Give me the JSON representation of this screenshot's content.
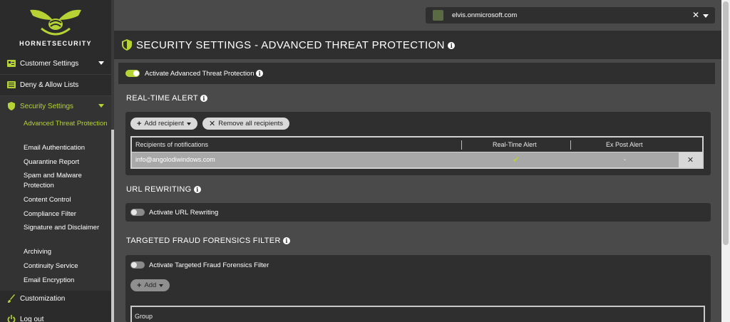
{
  "brand": {
    "logo_text": "HORNETSECURITY",
    "accent": "#b5d334"
  },
  "sidebar": {
    "top_items": [
      {
        "label": "Customer Settings",
        "icon": "id-card-icon"
      },
      {
        "label": "Deny & Allow Lists",
        "icon": "list-icon"
      },
      {
        "label": "Security Settings",
        "icon": "shield-icon"
      }
    ],
    "sub_items": [
      {
        "label": "Advanced Threat Protection",
        "active": true
      },
      {
        "label": "Email Authentication"
      },
      {
        "label": "Quarantine Report"
      },
      {
        "label": "Spam and Malware Protection"
      },
      {
        "label": "Content Control"
      },
      {
        "label": "Compliance Filter"
      },
      {
        "label": "Signature and Disclaimer"
      },
      {
        "label": "Archiving"
      },
      {
        "label": "Continuity Service"
      },
      {
        "label": "Email Encryption"
      }
    ],
    "bottom_items": [
      {
        "label": "Customization",
        "icon": "brush-icon"
      },
      {
        "label": "Log out",
        "icon": "power-icon"
      }
    ]
  },
  "topbar": {
    "tenant": "elvis.onmicrosoft.com"
  },
  "page": {
    "title": "SECURITY SETTINGS - ADVANCED THREAT PROTECTION",
    "activate_atp": "Activate Advanced Threat Protection"
  },
  "realtime": {
    "heading": "REAL-TIME ALERT",
    "add_recipient": "Add recipient",
    "remove_all": "Remove all recipients",
    "columns": [
      "Recipients of notifications",
      "Real-Time Alert",
      "Ex Post Alert"
    ],
    "rows": [
      {
        "email": "info@angolodiwindows.com",
        "realtime": "✔",
        "expost": "-"
      }
    ]
  },
  "url_rewriting": {
    "heading": "URL REWRITING",
    "activate": "Activate URL Rewriting"
  },
  "fraud": {
    "heading": "TARGETED FRAUD FORENSICS FILTER",
    "activate": "Activate Targeted Fraud Forensics Filter",
    "add": "Add",
    "group_col": "Group"
  }
}
